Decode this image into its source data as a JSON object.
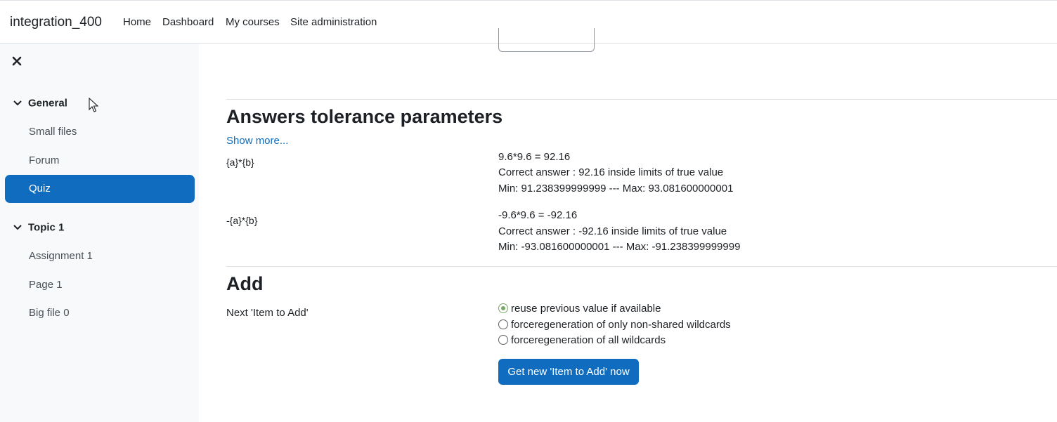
{
  "header": {
    "site_name": "integration_400",
    "nav": [
      "Home",
      "Dashboard",
      "My courses",
      "Site administration"
    ]
  },
  "drawer": {
    "sections": [
      {
        "title": "General",
        "items": [
          "Small files",
          "Forum",
          "Quiz"
        ]
      },
      {
        "title": "Topic 1",
        "items": [
          "Assignment 1",
          "Page 1",
          "Big file 0"
        ]
      }
    ],
    "active_item": "Quiz"
  },
  "tolerance": {
    "heading": "Answers tolerance parameters",
    "show_more": "Show more...",
    "rows": [
      {
        "formula": "{a}*{b}",
        "lines": [
          "9.6*9.6 = 92.16",
          "Correct answer : 92.16 inside limits of true value",
          "Min: 91.238399999999 --- Max: 93.081600000001"
        ]
      },
      {
        "formula": "-{a}*{b}",
        "lines": [
          "-9.6*9.6 = -92.16",
          "Correct answer : -92.16 inside limits of true value",
          "Min: -93.081600000001 --- Max: -91.238399999999"
        ]
      }
    ]
  },
  "add": {
    "heading": "Add",
    "label": "Next 'Item to Add'",
    "options": [
      {
        "label": "reuse previous value if available",
        "checked": true
      },
      {
        "label": "forceregeneration of only non-shared wildcards",
        "checked": false
      },
      {
        "label": "forceregeneration of all wildcards",
        "checked": false
      }
    ],
    "button": "Get new 'Item to Add' now"
  }
}
